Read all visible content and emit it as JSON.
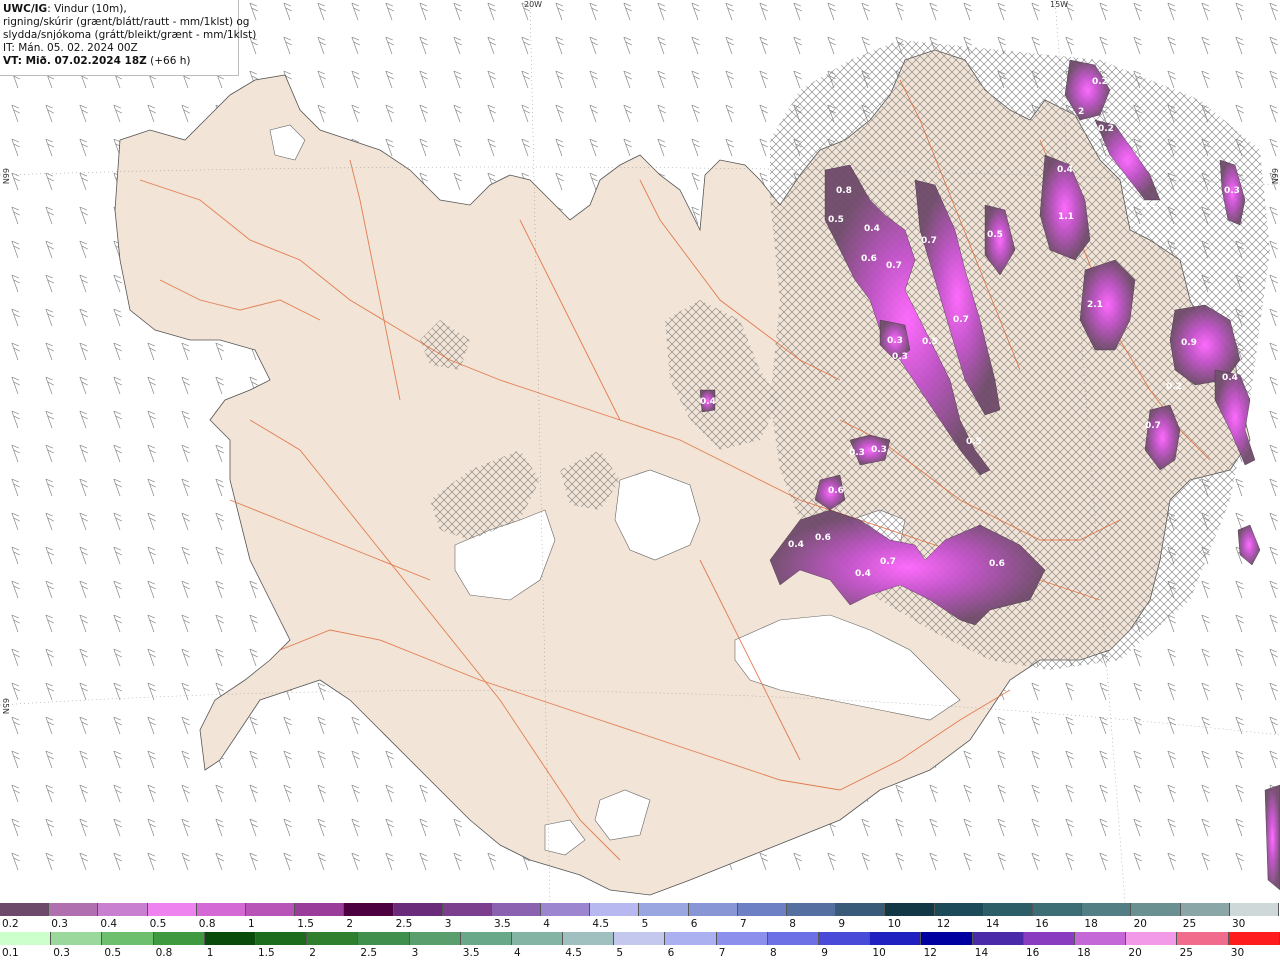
{
  "legend": {
    "product": "UWC/IG",
    "line1_rest": ": Vindur (10m),",
    "line2": "rigning/skúrir (grænt/blátt/rautt - mm/1klst) og",
    "line3": "slydda/snjókoma (grátt/bleikt/grænt - mm/1klst)",
    "line4": "IT: Mán. 05. 02. 2024 00Z",
    "vt_label": "VT: Mið. 07.02.2024 18Z",
    "vt_offset": " (+66 h)"
  },
  "grid_labels": {
    "lon_20w": "20W",
    "lon_15w": "15W",
    "lat_66n_left": "66N",
    "lat_65n_left": "65N",
    "lat_66n_right": "66N"
  },
  "snow_scale": {
    "labels": [
      "0.2",
      "0.3",
      "0.4",
      "0.5",
      "0.8",
      "1",
      "1.5",
      "2",
      "2.5",
      "3",
      "3.5",
      "4",
      "4.5",
      "5",
      "6",
      "7",
      "8",
      "9",
      "10",
      "12",
      "14",
      "16",
      "18",
      "20",
      "25",
      "30"
    ],
    "colors": [
      "#6e4a6a",
      "#b070b0",
      "#c97fd0",
      "#ee82ee",
      "#d468d4",
      "#b854b8",
      "#9a3c9a",
      "#4d0040",
      "#6a2c7a",
      "#7b3f8e",
      "#8a62b0",
      "#9b86cf",
      "#b8b8f0",
      "#9aa6e0",
      "#8896d6",
      "#6e80c4",
      "#5570a0",
      "#3a5a7a",
      "#113844",
      "#1c4a58",
      "#2c5e68",
      "#3d6e76",
      "#527e84",
      "#6a9092",
      "#8aa6a6",
      "#cfd8d8"
    ]
  },
  "rain_scale": {
    "labels": [
      "0.1",
      "0.3",
      "0.5",
      "0.8",
      "1",
      "1.5",
      "2",
      "2.5",
      "3",
      "3.5",
      "4",
      "4.5",
      "5",
      "6",
      "7",
      "8",
      "9",
      "10",
      "12",
      "14",
      "16",
      "18",
      "20",
      "25",
      "30"
    ],
    "colors": [
      "#ccffcc",
      "#9bd89b",
      "#6dbf6d",
      "#3f9a3f",
      "#0a4a0a",
      "#1d6b1d",
      "#2f7f2f",
      "#418f4c",
      "#5a9e6e",
      "#6aa88a",
      "#84b4a4",
      "#a0c0c0",
      "#c4c8ee",
      "#aab0f0",
      "#8c90ec",
      "#6d70e4",
      "#4a4ad8",
      "#2020c0",
      "#0000a0",
      "#4a2aa8",
      "#8a3cc0",
      "#c468d8",
      "#f29ae8",
      "#f06b8c",
      "#ff1c1c"
    ]
  },
  "precip_values": [
    "0.2",
    "2",
    "0.2",
    "0.8",
    "0.5",
    "0.4",
    "0.7",
    "0.6",
    "0.7",
    "0.5",
    "0.4",
    "1.1",
    "0.2",
    "0.3",
    "2.1",
    "0.7",
    "0.3",
    "0.5",
    "0.3",
    "0.9",
    "0.2",
    "0.4",
    "0.4",
    "0.5",
    "0.7",
    "0.3",
    "0.3",
    "0.6",
    "0.4",
    "0.6",
    "0.4",
    "0.7",
    "0.6"
  ]
}
